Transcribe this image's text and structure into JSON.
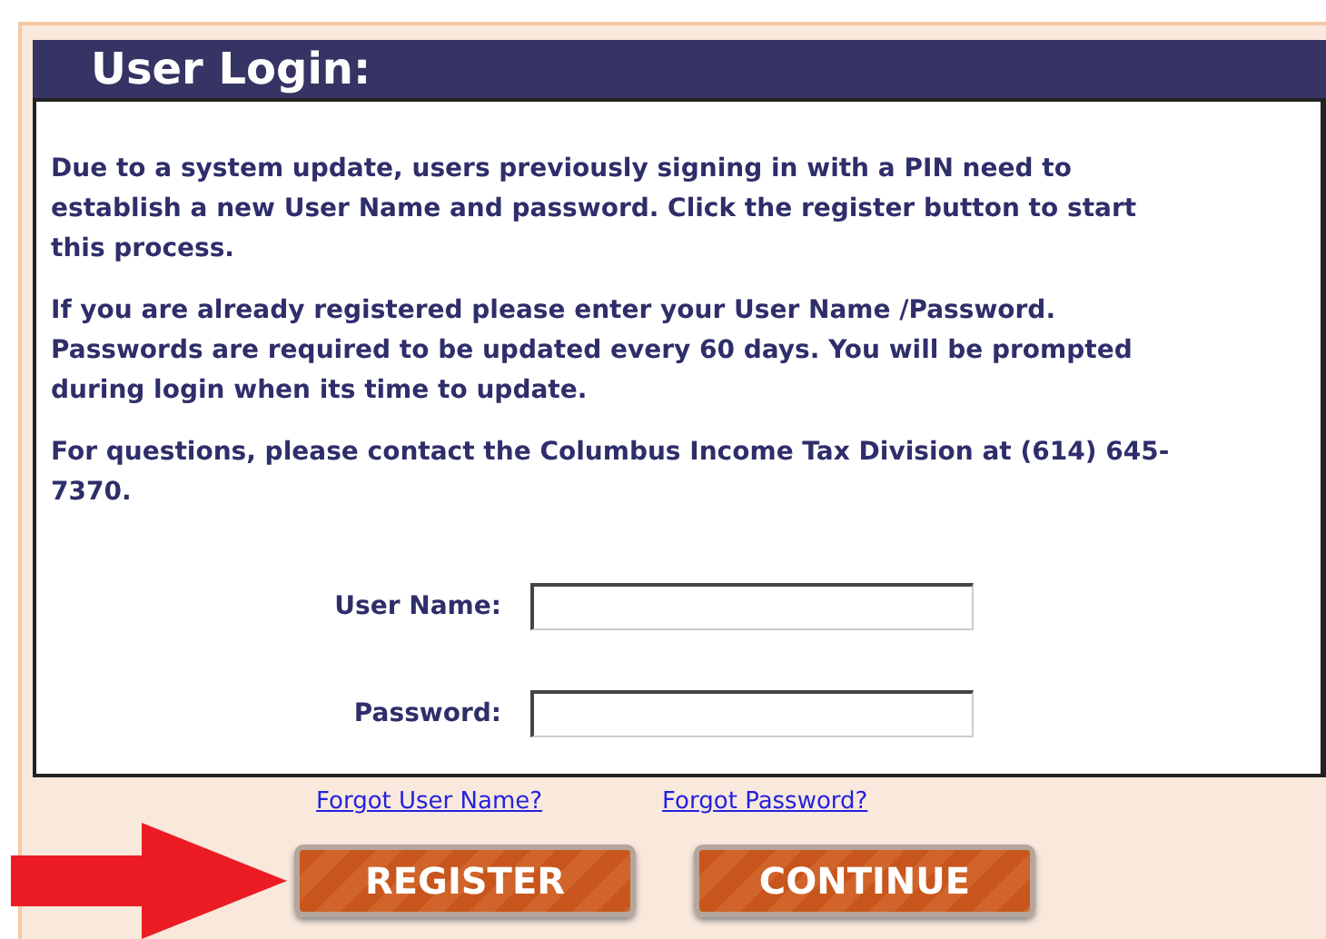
{
  "panel": {
    "title": "User Login:",
    "paragraphs": [
      "Due to a system update, users previously signing in with a PIN need to establish a new User Name and password. Click the register button to start this process.",
      "If you are already registered please enter your User Name /Password. Passwords are required to be updated every 60 days. You will be prompted during login when its time to update.",
      "For questions, please contact the Columbus Income Tax Division at (614) 645-7370."
    ],
    "fields": [
      {
        "label": "User Name:"
      },
      {
        "label": "Password:"
      }
    ]
  },
  "links": [
    "Forgot User Name?",
    "Forgot Password?"
  ],
  "buttons": [
    "REGISTER",
    "CONTINUE"
  ]
}
